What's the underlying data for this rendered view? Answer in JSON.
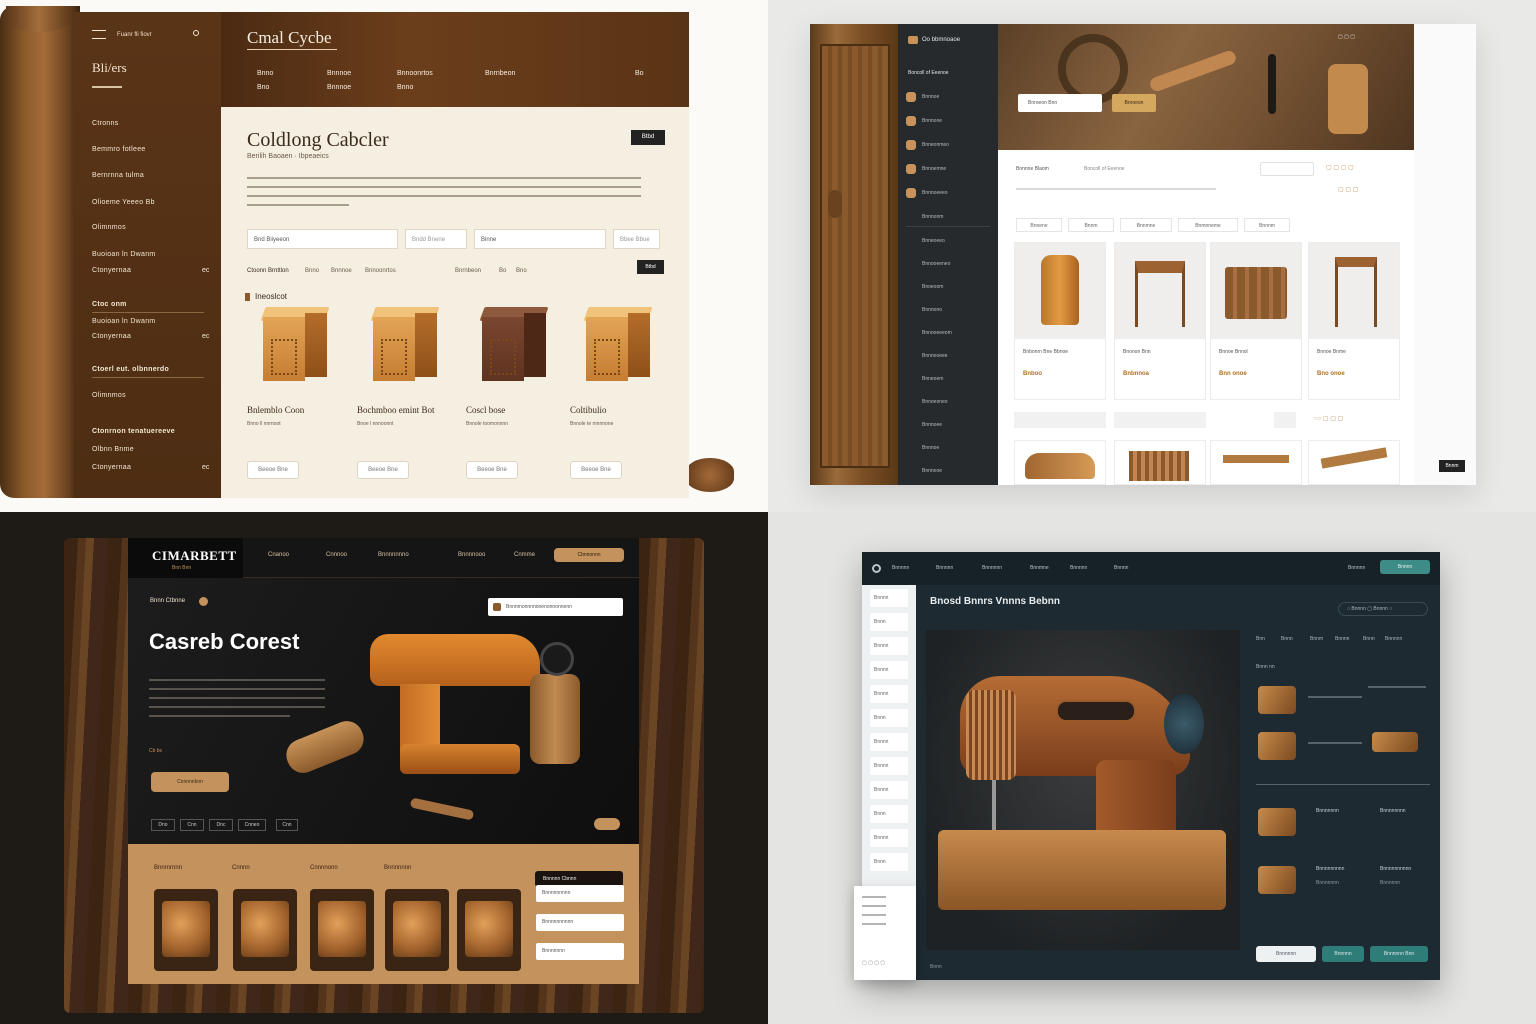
{
  "q1": {
    "logo": "Bli/ers",
    "brand": "Cmal Cycbe",
    "nav_top": "Fuanr fli fiovr",
    "heading": "Coldlong Cabcler",
    "subheading": "Berilih Baoaen · Ibpeaeics",
    "sidebar_items": [
      "Ctronns",
      "Bemmro fotleee",
      "Bernrnna tulma",
      "Olioeme Yeeeo Bb",
      "Olimnmos",
      "Buoioan ln Dwanm",
      "Ctonyernaa"
    ],
    "sidebar_count": "ec",
    "section2_title": "Ctoc onm",
    "section3_title": "Ctoerl eut. olbnnerdo",
    "section4_title": "Ctonrnon tenatuereeve",
    "section4_item": "Olbnn Bnme",
    "cta": "Btbd",
    "inputs": [
      "Bnd Biiyeeon",
      "Bndd Bnene",
      "Binne",
      "Bbee Bbue"
    ],
    "filter_label": "Ctoonn Brnttlon",
    "filters": [
      "Bnno",
      "Bnnnoe",
      "Bnnoonrtos",
      "Bnrnbeon",
      "Bo",
      "Bno"
    ],
    "tag": "Ineoslcot",
    "products": [
      {
        "name": "Bnlemblo Coon",
        "price": "Bnno ll nnrnoot"
      },
      {
        "name": "Bochmboo emint Bot",
        "price": "Bnoe l nnnoonnt"
      },
      {
        "name": "Coscl bose",
        "price": "Bnnole toomonnnn"
      },
      {
        "name": "Coltibulio",
        "price": "Bnnole te mnnnone"
      }
    ],
    "product_button": "Beeoe Bne"
  },
  "q2": {
    "brand": "Oo bbmnoaoe",
    "menu_title": "Boncoll of Eeenoe",
    "hero_btn1": "Bnroeon Bnn",
    "hero_btn2": "Bnroeon",
    "filter": "Bnnnne Blaom",
    "tabs": [
      "Bnnene",
      "Bnnm",
      "Bnnmne",
      "Bnmnneme",
      "Bnnnm"
    ],
    "products": [
      {
        "name": "Bnbonrn Bne Bbnoe",
        "price": "Bnboo"
      },
      {
        "name": "Bnonon Bnn",
        "price": "Bnbnnoa"
      },
      {
        "name": "Bnnoe Bnnol",
        "price": "Bnn onoe"
      },
      {
        "name": "Bnnoe Bnme",
        "price": "Bno onoe"
      }
    ],
    "side_items": [
      "Bnnnoe",
      "Bnnnooe",
      "Bnneonmeo",
      "Bnnoemne",
      "Bnnnoeeeo",
      "Bnnnonm",
      "Bnneoeeo",
      "Bnnooeeneo",
      "Bnoeoom",
      "Bnnnono",
      "Bnnooeeeom",
      "Bnnnooeee",
      "Bnneoem",
      "Bnnoeoneo",
      "Bnnnoee"
    ],
    "action": "Bnnm"
  },
  "q3": {
    "logo": "CIMARBETT",
    "logo_sub": "Bnn Bnn",
    "nav": [
      "Cnanoo",
      "Cnnnoo",
      "Bnnnnnnno",
      "Bnnnnooo",
      "Cnmme"
    ],
    "cta_pill": "Cbnnonnn",
    "badge": "Bnnn Ctbnne",
    "heading": "Casreb Corest",
    "paragraph_lines": [
      "",
      "",
      "",
      "",
      "",
      ""
    ],
    "bullet": "Cb bs",
    "btn": "Cnnnnnbnn",
    "mini_tabs": [
      "Dno",
      "Cnn",
      "Dnc",
      "Cnneo",
      "Cnn"
    ],
    "search": "Bnnnmonnnnonenonnonnenn",
    "lower_labels": [
      "Bnnrnrnnn",
      "Cnnnn",
      "Cnnnnonn",
      "Bnnnnnnn"
    ],
    "dropdown": "Bnnnnn Cbnnn",
    "fields": [
      "Bnnnnnnnnn",
      "Bnnnnnnnnnn",
      "Bnnnnnnn"
    ]
  },
  "q4": {
    "nav": [
      "Bnnnnn",
      "Bnnnnn",
      "Bnnnnnn",
      "Bnnmne",
      "Bnnnnn",
      "Bnnnn"
    ],
    "btn_top": "Bnnnn",
    "title": "Bnosd Bnnrs Vnnns Bebnn",
    "toolbar": [
      "Bnnnn",
      "Bnnnnn",
      "Bnnn"
    ],
    "tabs": [
      "Bnn",
      "Bnnn",
      "Bnnm",
      "Bnnnn",
      "Bnnn",
      "Bnnnnn"
    ],
    "side": [
      "Bnnnn",
      "Bnnn",
      "Bnnnn",
      "Bnnnn",
      "Bnnnn",
      "Bnnn",
      "Bnnnn",
      "Bnnnn",
      "Bnnnn",
      "Bnnn"
    ],
    "list_title": "Bnnn nn",
    "items": [
      "Bnnnnnnn",
      "Bnnnnnnnn",
      "Bnnnnnnnnn",
      "Bnnnnnnnnnn",
      "Bnnnnnnn",
      "Bnnnnnn"
    ],
    "btn1": "Bnnnnnn",
    "btn2": "Bnnnnn",
    "btn3": "Bnnnnnn Bnn",
    "footer": "Bnnn"
  }
}
